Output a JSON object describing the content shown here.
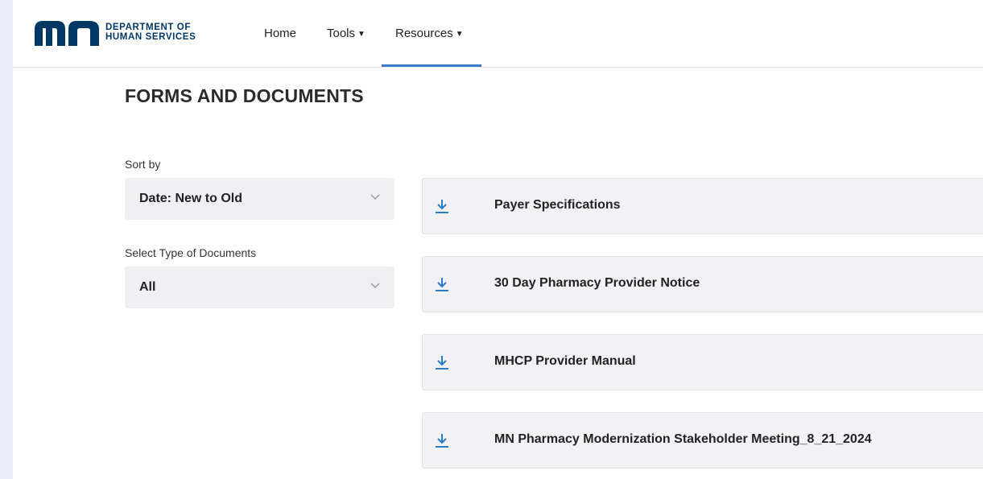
{
  "header": {
    "logo": {
      "line1": "DEPARTMENT OF",
      "line2": "HUMAN SERVICES",
      "mark_color": "#003865"
    },
    "nav": [
      {
        "label": "Home",
        "has_dropdown": false
      },
      {
        "label": "Tools",
        "has_dropdown": true
      },
      {
        "label": "Resources",
        "has_dropdown": true,
        "active": true
      }
    ],
    "accent_color": "#3a7ec6"
  },
  "page": {
    "title": "FORMS AND DOCUMENTS"
  },
  "filters": {
    "sort": {
      "label": "Sort by",
      "value": "Date: New to Old"
    },
    "type": {
      "label": "Select Type of Documents",
      "value": "All"
    }
  },
  "documents": [
    {
      "title": "Payer Specifications",
      "icon": "download-icon"
    },
    {
      "title": "30 Day Pharmacy Provider Notice",
      "icon": "download-icon"
    },
    {
      "title": "MHCP Provider Manual",
      "icon": "download-icon"
    },
    {
      "title": "MN Pharmacy Modernization Stakeholder Meeting_8_21_2024",
      "icon": "download-icon"
    }
  ]
}
